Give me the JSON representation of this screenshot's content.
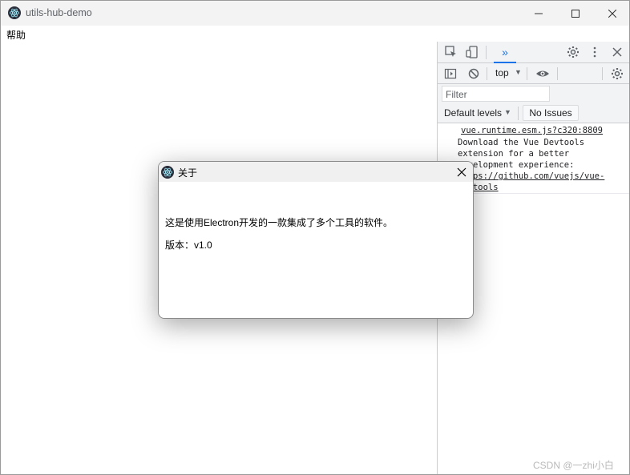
{
  "window": {
    "title": "utils-hub-demo"
  },
  "menu": {
    "help": "帮助"
  },
  "devtools": {
    "tab_more": "»",
    "context": "top",
    "filter_placeholder": "Filter",
    "levels": "Default levels",
    "issues": "No Issues",
    "console": {
      "source": "vue.runtime.esm.js?c320:8809",
      "text_line1": "Download the Vue Devtools",
      "text_line2": "extension for a better",
      "text_line3": "development experience:",
      "link_line1": "https://github.com/vuejs/vue-",
      "link_line2": "devtools"
    }
  },
  "dialog": {
    "title": "关于",
    "description": "这是使用Electron开发的一款集成了多个工具的软件。",
    "version": "版本：v1.0"
  },
  "watermark": "CSDN @一zhi小白",
  "colors": {
    "accent": "#1a73e8",
    "titlebar": "#f3f3f3",
    "devtools_bg": "#f1f3f4"
  }
}
